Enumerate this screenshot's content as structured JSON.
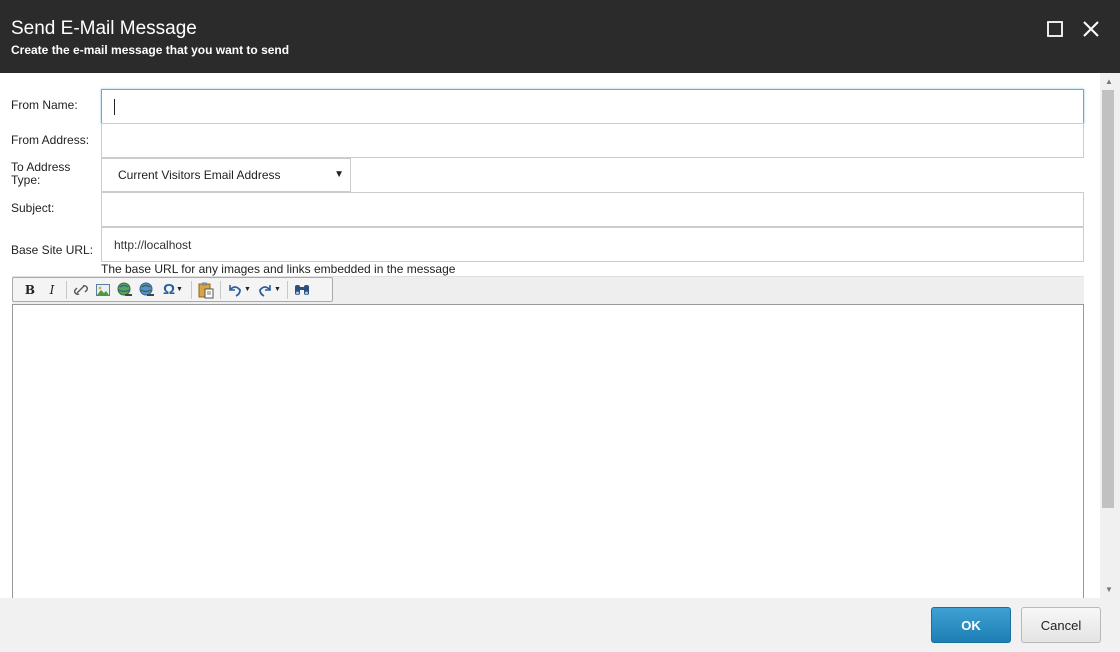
{
  "dialog": {
    "title": "Send E-Mail Message",
    "subtitle": "Create the e-mail message that you want to send"
  },
  "form": {
    "from_name": {
      "label": "From Name:",
      "value": ""
    },
    "from_address": {
      "label": "From Address:",
      "value": ""
    },
    "to_address_type": {
      "label": "To Address Type:",
      "selected": "Current Visitors Email Address"
    },
    "subject": {
      "label": "Subject:",
      "value": ""
    },
    "base_site_url": {
      "label": "Base Site URL:",
      "value": "http://localhost",
      "hint": "The base URL for any images and links embedded in the message"
    }
  },
  "toolbar": {
    "bold": "B",
    "italic": "I",
    "special_char": "Ω",
    "icons": [
      "bold-icon",
      "italic-icon",
      "link-icon",
      "image-icon",
      "insert-link-icon",
      "remove-link-icon",
      "omega-icon",
      "paste-icon",
      "undo-icon",
      "redo-icon",
      "find-icon"
    ]
  },
  "footer": {
    "ok_label": "OK",
    "cancel_label": "Cancel"
  },
  "colors": {
    "header_bg": "#2b2b2b",
    "primary_button": "#1d7fb5",
    "focus_border": "#5bb0dd"
  }
}
